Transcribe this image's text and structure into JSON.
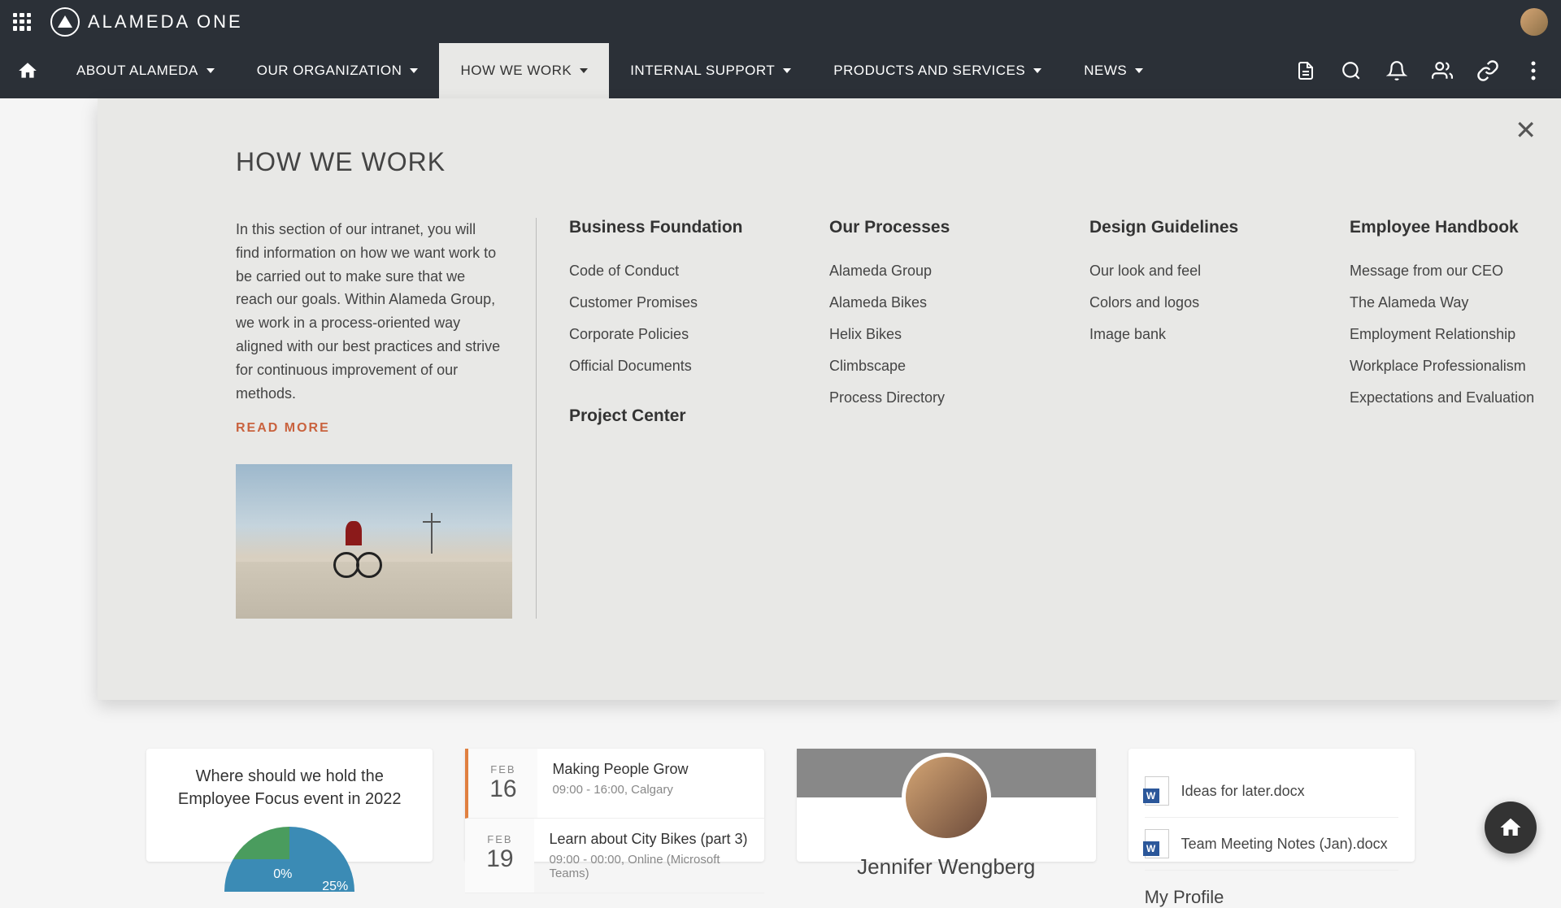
{
  "brand": "ALAMEDA ONE",
  "nav": {
    "items": [
      {
        "label": "ABOUT ALAMEDA"
      },
      {
        "label": "OUR ORGANIZATION"
      },
      {
        "label": "HOW WE WORK"
      },
      {
        "label": "INTERNAL SUPPORT"
      },
      {
        "label": "PRODUCTS AND SERVICES"
      },
      {
        "label": "NEWS"
      }
    ]
  },
  "mega": {
    "title": "HOW WE WORK",
    "description": "In this section of our intranet, you will find information on how we want work to be carried out to make sure that we reach our goals. Within Alameda Group, we work in a process-oriented way aligned with our best practices and strive for continuous improvement of our methods.",
    "read_more": "READ MORE",
    "columns": [
      {
        "title": "Business Foundation",
        "links": [
          "Code of Conduct",
          "Customer Promises",
          "Corporate Policies",
          "Official Documents"
        ],
        "extraTitle": "Project Center"
      },
      {
        "title": "Our Processes",
        "links": [
          "Alameda Group",
          "Alameda Bikes",
          "Helix Bikes",
          "Climbscape",
          "Process Directory"
        ]
      },
      {
        "title": "Design Guidelines",
        "links": [
          "Our look and feel",
          "Colors and logos",
          "Image bank"
        ]
      },
      {
        "title": "Employee Handbook",
        "links": [
          "Message from our CEO",
          "The Alameda Way",
          "Employment Relationship",
          "Workplace Professionalism",
          "Expectations and Evaluation"
        ]
      }
    ]
  },
  "poll": {
    "question": "Where should we hold the Employee Focus event in 2022",
    "labels": [
      "0%",
      "25%"
    ]
  },
  "events": [
    {
      "month": "FEB",
      "day": "16",
      "title": "Making People Grow",
      "meta": "09:00 - 16:00, Calgary"
    },
    {
      "month": "FEB",
      "day": "19",
      "title": "Learn about City Bikes (part 3)",
      "meta": "09:00 - 00:00, Online (Microsoft Teams)"
    }
  ],
  "profile": {
    "name": "Jennifer Wengberg"
  },
  "files": {
    "items": [
      {
        "name": "Ideas for later.docx"
      },
      {
        "name": "Team Meeting Notes (Jan).docx"
      }
    ],
    "section_title": "My Profile"
  },
  "chart_data": {
    "type": "pie",
    "title": "Where should we hold the Employee Focus event in 2022",
    "slices": [
      {
        "label": "0%",
        "value": 0,
        "color": "#4a9c5e"
      },
      {
        "label": "25%",
        "value": 25,
        "color": "#3b8bb5"
      }
    ]
  }
}
